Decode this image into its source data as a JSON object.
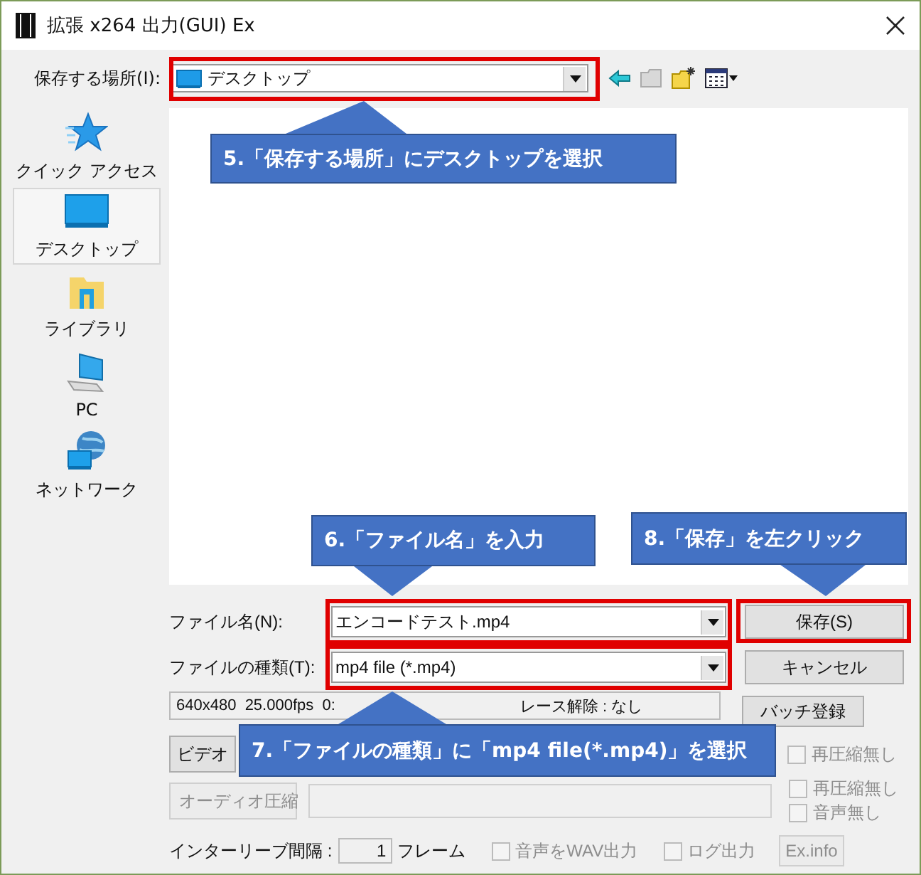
{
  "window": {
    "title": "拡張 x264 出力(GUI) Ex"
  },
  "location": {
    "label": "保存する場所(I):",
    "value": "デスクトップ"
  },
  "sidebar": {
    "items": [
      {
        "label": "クイック アクセス",
        "kind": "star",
        "selected": false
      },
      {
        "label": "デスクトップ",
        "kind": "desktop",
        "selected": true
      },
      {
        "label": "ライブラリ",
        "kind": "library",
        "selected": false
      },
      {
        "label": "PC",
        "kind": "pc",
        "selected": false
      },
      {
        "label": "ネットワーク",
        "kind": "network",
        "selected": false
      }
    ]
  },
  "filename": {
    "label": "ファイル名(N):",
    "value": "エンコードテスト.mp4"
  },
  "filetype": {
    "label": "ファイルの種類(T):",
    "value": "mp4 file (*.mp4)"
  },
  "buttons": [
    {
      "label": "保存(S)"
    },
    {
      "label": "キャンセル"
    },
    {
      "label": "バッチ登録"
    }
  ],
  "info": {
    "left": "640x480  25.000fps  0:",
    "right": "レース解除 : なし"
  },
  "video": {
    "button": "ビデオ",
    "disabled": false,
    "checkboxes": [
      {
        "label": "再圧縮無し",
        "checked": false,
        "disabled": true
      }
    ]
  },
  "audio": {
    "button": "オーディオ圧縮",
    "disabled": true,
    "checkboxes": [
      {
        "label": "再圧縮無し",
        "checked": false,
        "disabled": true
      },
      {
        "label": "音声無し",
        "checked": false,
        "disabled": true
      }
    ]
  },
  "interleave": {
    "label": "インターリーブ間隔 :",
    "value": "1",
    "unit": "フレーム"
  },
  "options": [
    {
      "label": "音声をWAV出力",
      "checked": false,
      "disabled": true
    },
    {
      "label": "ログ出力",
      "checked": false,
      "disabled": true
    }
  ],
  "exinfo": {
    "label": "Ex.info",
    "disabled": true
  },
  "callouts": [
    {
      "text": "5.「保存する場所」にデスクトップを選択",
      "kind": "up"
    },
    {
      "text": "6.「ファイル名」を入力",
      "kind": "down"
    },
    {
      "text": "8.「保存」を左クリック",
      "kind": "down"
    },
    {
      "text": "7.「ファイルの種類」に「mp4 file(*.mp4)」を選択",
      "kind": "up"
    }
  ]
}
